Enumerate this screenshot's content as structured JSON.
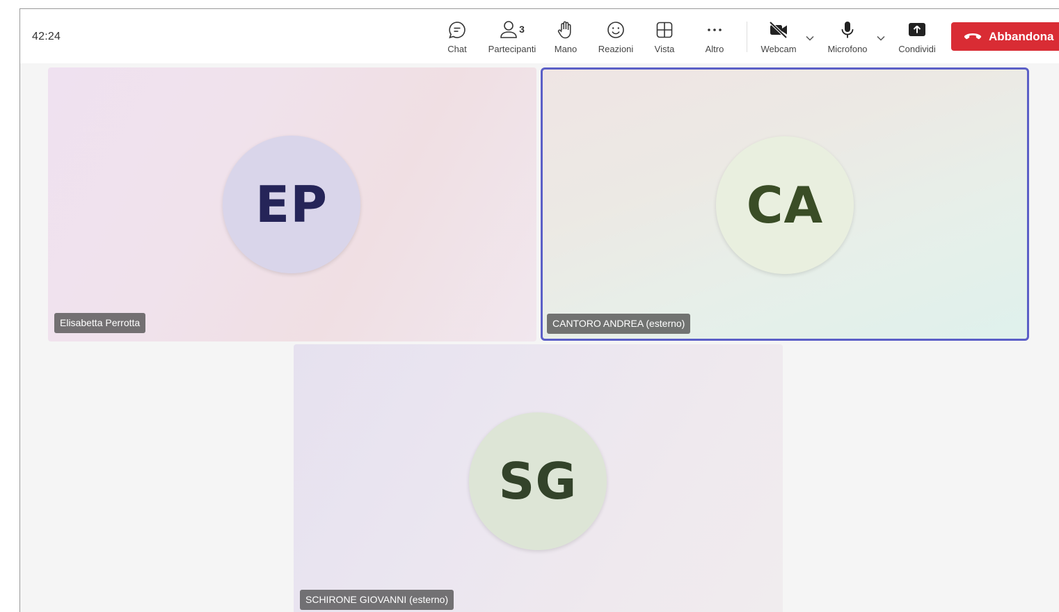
{
  "header": {
    "timer": "42:24",
    "toolbar": {
      "chat": "Chat",
      "participants": "Partecipanti",
      "participants_count": "3",
      "hand": "Mano",
      "reactions": "Reazioni",
      "view": "Vista",
      "more": "Altro",
      "webcam": "Webcam",
      "microphone": "Microfono",
      "share": "Condividi",
      "leave": "Abbandona"
    }
  },
  "participants": [
    {
      "initials": "EP",
      "name": "Elisabetta Perrotta",
      "avatar_bg": "#d9d5ea",
      "initials_color": "#252458"
    },
    {
      "initials": "CA",
      "name": "CANTORO ANDREA (esterno)",
      "avatar_bg": "#e9efdf",
      "initials_color": "#3a4d26",
      "active_speaker": true
    },
    {
      "initials": "SG",
      "name": "SCHIRONE GIOVANNI (esterno)",
      "avatar_bg": "#dde5d6",
      "initials_color": "#33432a"
    }
  ],
  "colors": {
    "accent": "#5b5fc7",
    "leave_button": "#d92c34"
  }
}
